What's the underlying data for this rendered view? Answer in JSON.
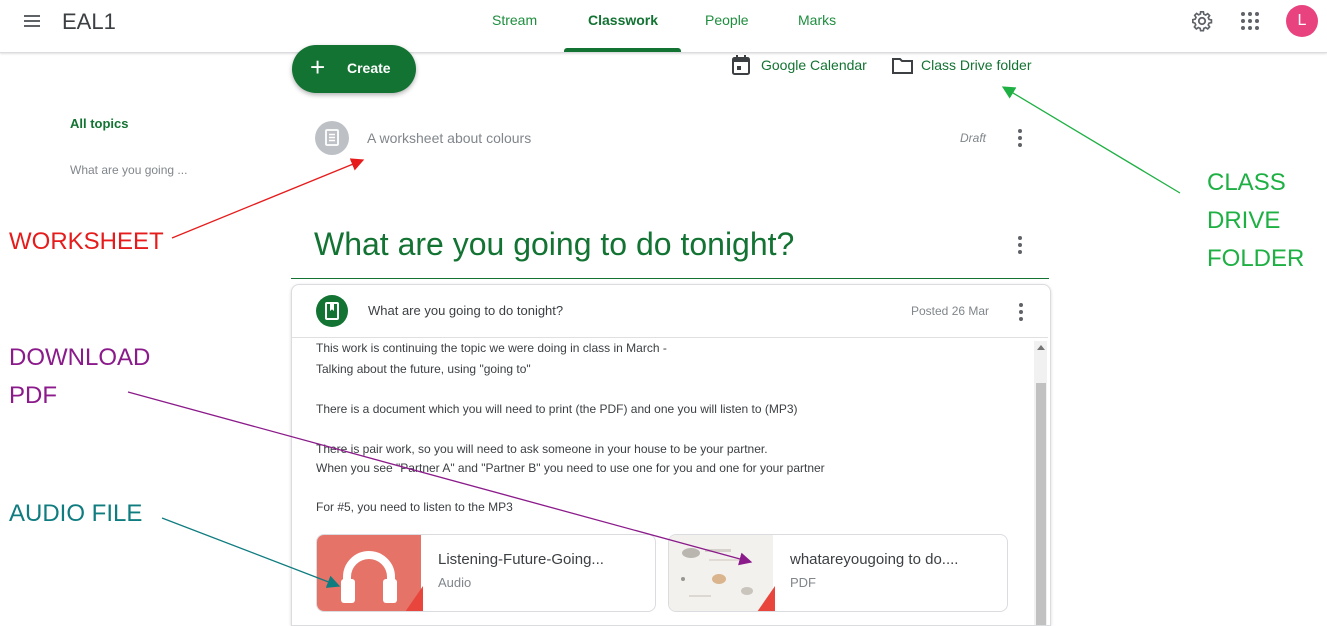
{
  "header": {
    "app_title": "EAL1",
    "tabs": [
      {
        "label": "Stream"
      },
      {
        "label": "Classwork"
      },
      {
        "label": "People"
      },
      {
        "label": "Marks"
      }
    ],
    "active_tab": "Classwork",
    "avatar_initial": "L",
    "avatar_color": "#e8437f"
  },
  "toolbar": {
    "create_label": "Create",
    "calendar_label": "Google Calendar",
    "drive_label": "Class Drive folder"
  },
  "sidebar": {
    "all_topics_label": "All topics",
    "topics": [
      "What are you going ..."
    ]
  },
  "draft_item": {
    "title": "A worksheet about colours",
    "status": "Draft"
  },
  "topic": {
    "heading": "What are you going to do tonight?"
  },
  "assignment": {
    "title": "What are you going to do tonight?",
    "posted": "Posted 26 Mar",
    "description_lines": [
      "This work is continuing the topic we were doing in class in March -",
      "Talking about the future, using \"going to\"",
      "There is a document which you will need to print (the PDF) and one you will listen to (MP3)",
      "There is pair work, so you will need to ask someone in your house to be your partner.",
      "When you see \"Partner A\" and \"Partner B\" you need to use one for you and one for your partner",
      "For #5, you need to listen to the MP3"
    ],
    "attachments": [
      {
        "title": "Listening-Future-Going...",
        "type": "Audio"
      },
      {
        "title": "whatareyougoing to do....",
        "type": "PDF"
      }
    ]
  },
  "annotations": {
    "worksheet": "WORKSHEET",
    "class_drive_folder": [
      "CLASS",
      "DRIVE",
      "FOLDER"
    ],
    "download_pdf": [
      "DOWNLOAD",
      "PDF"
    ],
    "audio_file": "AUDIO FILE"
  },
  "colors": {
    "brand_green": "#137333",
    "annotation_red": "#e61c1c",
    "annotation_purple": "#8b1a8b",
    "annotation_teal": "#0f7c80",
    "annotation_green": "#1eb043"
  }
}
